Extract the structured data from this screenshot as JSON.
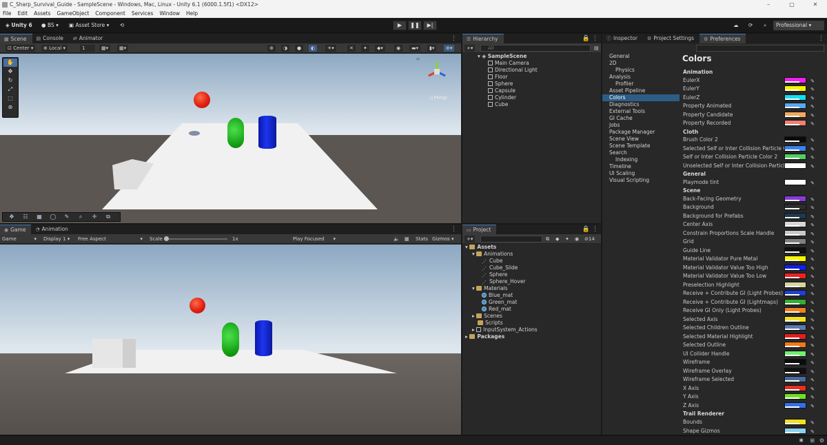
{
  "window": {
    "title": "C_Sharp_Survival_Guide - SampleScene - Windows, Mac, Linux - Unity 6.1 (6000.1.5f1) <DX12>",
    "controls": [
      "–",
      "▢",
      "✕"
    ]
  },
  "menu": [
    "File",
    "Edit",
    "Assets",
    "GameObject",
    "Component",
    "Services",
    "Window",
    "Help"
  ],
  "toolbar": {
    "unity_label": "Unity 6",
    "account": "BS",
    "asset_store": "Asset Store",
    "layout": "Professional"
  },
  "scene_panel": {
    "tabs": [
      "Scene",
      "Console",
      "Animator"
    ],
    "pivot": "Center",
    "space": "Local",
    "snap_value": "1",
    "persp": "◁ Persp"
  },
  "game_panel": {
    "tabs": [
      "Game",
      "Animation"
    ],
    "mode": "Game",
    "display": "Display 1",
    "aspect": "Free Aspect",
    "scale_label": "Scale",
    "scale_value": "1x",
    "play_mode": "Play Focused",
    "stats": "Stats",
    "gizmos": "Gizmos"
  },
  "hierarchy": {
    "tab": "Hierarchy",
    "search_placeholder": "All",
    "scene": "SampleScene",
    "items": [
      "Main Camera",
      "Directional Light",
      "Floor",
      "Sphere",
      "Capsule",
      "Cylinder",
      "Cube"
    ]
  },
  "project": {
    "tab": "Project",
    "count": "14",
    "root": "Assets",
    "animations_folder": "Animations",
    "animations": [
      "Cube",
      "Cube_Slide",
      "Sphere",
      "Sphere_Hover"
    ],
    "materials_folder": "Materials",
    "materials": [
      "Blue_mat",
      "Green_mat",
      "Red_mat"
    ],
    "other_folders": [
      "Scenes",
      "Scripts",
      "InputSystem_Actions"
    ],
    "packages": "Packages"
  },
  "inspector_tabs": [
    "Inspector",
    "Project Settings",
    "Preferences"
  ],
  "preferences": {
    "title": "Colors",
    "nav": [
      {
        "label": "General",
        "sub": false,
        "selected": false
      },
      {
        "label": "2D",
        "sub": false,
        "selected": false
      },
      {
        "label": "Physics",
        "sub": true,
        "selected": false
      },
      {
        "label": "Analysis",
        "sub": false,
        "selected": false
      },
      {
        "label": "Profiler",
        "sub": true,
        "selected": false
      },
      {
        "label": "Asset Pipeline",
        "sub": false,
        "selected": false
      },
      {
        "label": "Colors",
        "sub": false,
        "selected": true
      },
      {
        "label": "Diagnostics",
        "sub": false,
        "selected": false
      },
      {
        "label": "External Tools",
        "sub": false,
        "selected": false
      },
      {
        "label": "GI Cache",
        "sub": false,
        "selected": false
      },
      {
        "label": "Jobs",
        "sub": false,
        "selected": false
      },
      {
        "label": "Package Manager",
        "sub": false,
        "selected": false
      },
      {
        "label": "Scene View",
        "sub": false,
        "selected": false
      },
      {
        "label": "Scene Template",
        "sub": false,
        "selected": false
      },
      {
        "label": "Search",
        "sub": false,
        "selected": false
      },
      {
        "label": "Indexing",
        "sub": true,
        "selected": false
      },
      {
        "label": "Timeline",
        "sub": false,
        "selected": false
      },
      {
        "label": "UI Scaling",
        "sub": false,
        "selected": false
      },
      {
        "label": "Visual Scripting",
        "sub": false,
        "selected": false
      }
    ],
    "rows": [
      {
        "header": "Animation"
      },
      {
        "label": "EulerX",
        "color": "#f020f0"
      },
      {
        "label": "EulerY",
        "color": "#f5f500"
      },
      {
        "label": "EulerZ",
        "color": "#10e0f0"
      },
      {
        "label": "Property Animated",
        "color": "#5aa8f0"
      },
      {
        "label": "Property Candidate",
        "color": "#f0a860"
      },
      {
        "label": "Property Recorded",
        "color": "#f08070"
      },
      {
        "header": "Cloth"
      },
      {
        "label": "Brush Color 2",
        "color": "#0a0a0a"
      },
      {
        "label": "Selected Self or Inter Collision Particle Col...",
        "color": "#3c82f0"
      },
      {
        "label": "Self or Inter Collision Particle Color 2",
        "color": "#50d060"
      },
      {
        "label": "Unselected Self or Inter Collision Particle ...",
        "color": "#ffffff"
      },
      {
        "header": "General"
      },
      {
        "label": "Playmode tint",
        "color": "#ffffff"
      },
      {
        "header": "Scene"
      },
      {
        "label": "Back-Facing Geometry",
        "color": "#8a3ad8"
      },
      {
        "label": "Background",
        "color": "#2e2e2e"
      },
      {
        "label": "Background for Prefabs",
        "color": "#1e3a50"
      },
      {
        "label": "Center Axis",
        "color": "#d8d8d8"
      },
      {
        "label": "Constrain Proportions Scale Handle",
        "color": "#c8c8c8"
      },
      {
        "label": "Grid",
        "color": "#808080"
      },
      {
        "label": "Guide Line",
        "color": "#101010"
      },
      {
        "label": "Material Validator Pure Metal",
        "color": "#f5f500"
      },
      {
        "label": "Material Validator Value Too High",
        "color": "#1020f0"
      },
      {
        "label": "Material Validator Value Too Low",
        "color": "#f02020"
      },
      {
        "label": "Preselection Highlight",
        "color": "#d8d4a0"
      },
      {
        "label": "Receive + Contribute GI (Light Probes)",
        "color": "#2040d0"
      },
      {
        "label": "Receive + Contribute GI (Lightmaps)",
        "color": "#30b030"
      },
      {
        "label": "Receive GI Only (Light Probes)",
        "color": "#f08020"
      },
      {
        "label": "Selected Axis",
        "color": "#f5e020"
      },
      {
        "label": "Selected Children Outline",
        "color": "#5a7ab0"
      },
      {
        "label": "Selected Material Highlight",
        "color": "#e02020"
      },
      {
        "label": "Selected Outline",
        "color": "#f07818"
      },
      {
        "label": "UI Collider Handle",
        "color": "#70f070"
      },
      {
        "label": "Wireframe",
        "color": "#0c0c0c"
      },
      {
        "label": "Wireframe Overlay",
        "color": "#101010"
      },
      {
        "label": "Wireframe Selected",
        "color": "#4a6a9a"
      },
      {
        "label": "X Axis",
        "color": "#e83020"
      },
      {
        "label": "Y Axis",
        "color": "#70e020"
      },
      {
        "label": "Z Axis",
        "color": "#3070e8"
      },
      {
        "header": "Trail Renderer"
      },
      {
        "label": "Bounds",
        "color": "#f0e020"
      },
      {
        "label": "Shape Gizmos",
        "color": "#8ad0f0"
      }
    ]
  }
}
